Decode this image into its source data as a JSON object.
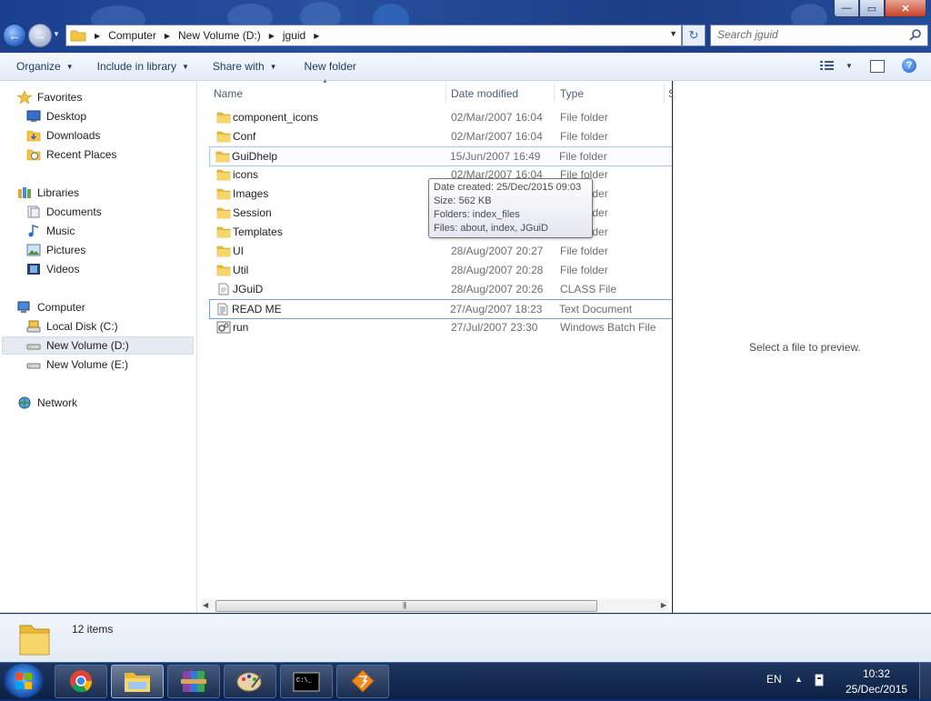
{
  "window": {
    "controls": {
      "minimize": "—",
      "maximize": "▭",
      "close": "✕"
    }
  },
  "address": {
    "crumbs": [
      "Computer",
      "New Volume (D:)",
      "jguid"
    ],
    "search_placeholder": "Search jguid"
  },
  "toolbar": {
    "organize": "Organize",
    "include_in_library": "Include in library",
    "share_with": "Share with",
    "new_folder": "New folder"
  },
  "nav": {
    "favorites": "Favorites",
    "desktop": "Desktop",
    "downloads": "Downloads",
    "recent_places": "Recent Places",
    "libraries": "Libraries",
    "documents": "Documents",
    "music": "Music",
    "pictures": "Pictures",
    "videos": "Videos",
    "computer": "Computer",
    "local_disk_c": "Local Disk (C:)",
    "new_volume_d": "New Volume (D:)",
    "new_volume_e": "New Volume (E:)",
    "network": "Network",
    "selected": "New Volume (D:)"
  },
  "columns": {
    "name": "Name",
    "date_modified": "Date modified",
    "type": "Type",
    "size": "S"
  },
  "files": [
    {
      "name": "component_icons",
      "date": "02/Mar/2007 16:04",
      "type": "File folder",
      "icon": "folder-icon"
    },
    {
      "name": "Conf",
      "date": "02/Mar/2007 16:04",
      "type": "File folder",
      "icon": "folder-icon"
    },
    {
      "name": "GuiDhelp",
      "date": "15/Jun/2007 16:49",
      "type": "File folder",
      "icon": "folder-icon"
    },
    {
      "name": "icons",
      "date": "02/Mar/2007 16:04",
      "type": "File folder",
      "icon": "folder-icon"
    },
    {
      "name": "Images",
      "date": "",
      "type": "File folder",
      "icon": "folder-icon"
    },
    {
      "name": "Session",
      "date": "",
      "type": "File folder",
      "icon": "folder-icon"
    },
    {
      "name": "Templates",
      "date": "",
      "type": "File folder",
      "icon": "folder-icon"
    },
    {
      "name": "UI",
      "date": "28/Aug/2007 20:27",
      "type": "File folder",
      "icon": "folder-icon"
    },
    {
      "name": "Util",
      "date": "28/Aug/2007 20:28",
      "type": "File folder",
      "icon": "folder-icon"
    },
    {
      "name": "JGuiD",
      "date": "28/Aug/2007 20:26",
      "type": "CLASS File",
      "icon": "class-file-icon"
    },
    {
      "name": "READ ME",
      "date": "27/Aug/2007 18:23",
      "type": "Text Document",
      "icon": "text-file-icon"
    },
    {
      "name": "run",
      "date": "27/Jul/2007 23:30",
      "type": "Windows Batch File",
      "icon": "batch-file-icon"
    }
  ],
  "tooltip": {
    "date_created": "Date created: 25/Dec/2015 09:03",
    "size": "Size: 562 KB",
    "folders": "Folders: index_files",
    "files": "Files: about, index, JGuiD"
  },
  "preview": {
    "empty_text": "Select a file to preview."
  },
  "details": {
    "item_count": "12 items"
  },
  "taskbar": {
    "apps": [
      "chrome-icon",
      "explorer-icon",
      "winrar-icon",
      "paint-icon",
      "cmd-icon",
      "app-icon"
    ],
    "language": "EN",
    "time": "10:32",
    "date": "25/Dec/2015"
  },
  "colors": {
    "accent": "#1d3e86",
    "selection": "#e5eaf3",
    "hover_border": "#a8c6ea",
    "folder": "#f4c542"
  }
}
